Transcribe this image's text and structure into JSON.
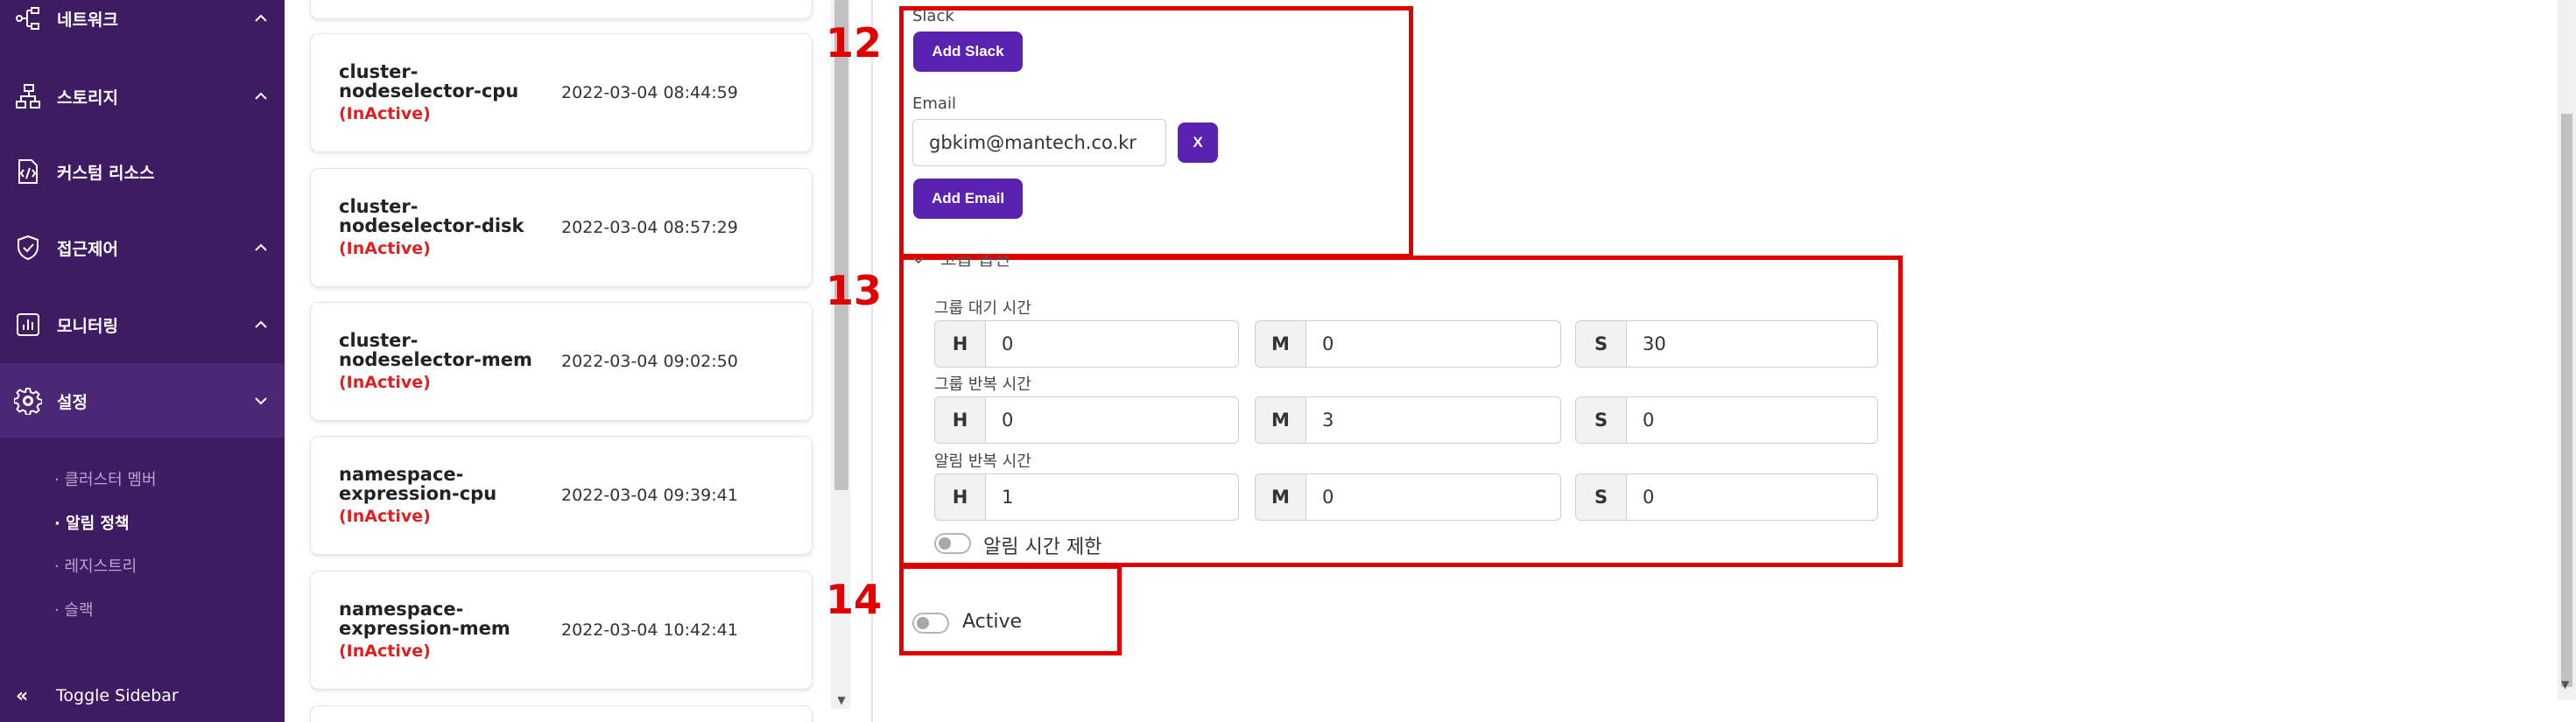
{
  "sidebar": {
    "items": [
      {
        "label": "네트워크",
        "icon": "network-icon",
        "chevron": "up"
      },
      {
        "label": "스토리지",
        "icon": "storage-icon",
        "chevron": "up"
      },
      {
        "label": "커스텀 리소스",
        "icon": "custom-resource-icon",
        "chevron": ""
      },
      {
        "label": "접근제어",
        "icon": "shield-check-icon",
        "chevron": "up"
      },
      {
        "label": "모니터링",
        "icon": "bar-chart-icon",
        "chevron": "up"
      },
      {
        "label": "설정",
        "icon": "gear-icon",
        "chevron": "down"
      }
    ],
    "sub_items": [
      "· 클러스터 멤버",
      "· 알림 정책",
      "· 레지스트리",
      "· 슬랙"
    ],
    "toggle_label": "Toggle Sidebar",
    "toggle_chevron": "«"
  },
  "policies": [
    {
      "name": "cluster-nodeselector-cpu",
      "status": "(InActive)",
      "date": "2022-03-04 08:44:59"
    },
    {
      "name": "cluster-nodeselector-disk",
      "status": "(InActive)",
      "date": "2022-03-04 08:57:29"
    },
    {
      "name": "cluster-nodeselector-mem",
      "status": "(InActive)",
      "date": "2022-03-04 09:02:50"
    },
    {
      "name": "namespace-expression-cpu",
      "status": "(InActive)",
      "date": "2022-03-04 09:39:41"
    },
    {
      "name": "namespace-expression-mem",
      "status": "(InActive)",
      "date": "2022-03-04 10:42:41"
    }
  ],
  "annotations": {
    "a12": "12",
    "a13": "13",
    "a14": "14"
  },
  "slack": {
    "label": "Slack",
    "add_button": "Add Slack"
  },
  "email": {
    "label": "Email",
    "value": "gbkim@mantech.co.kr",
    "remove_button": "X",
    "add_button": "Add Email"
  },
  "advanced": {
    "toggle_label": "고급 옵션",
    "group_wait": {
      "label": "그룹 대기 시간",
      "H": "0",
      "M": "0",
      "S": "30"
    },
    "group_repeat": {
      "label": "그룹 반복 시간",
      "H": "0",
      "M": "3",
      "S": "0"
    },
    "alert_repeat": {
      "label": "알림 반복 시간",
      "H": "1",
      "M": "0",
      "S": "0"
    },
    "unit_labels": {
      "H": "H",
      "M": "M",
      "S": "S"
    },
    "time_limit_label": "알림 시간 제한",
    "time_limit_on": false
  },
  "active": {
    "label": "Active",
    "on": false
  },
  "colors": {
    "sidebar": "#3f1b63",
    "primary": "#5a22b0",
    "annotation": "#e10000",
    "inactive": "#e02020"
  }
}
